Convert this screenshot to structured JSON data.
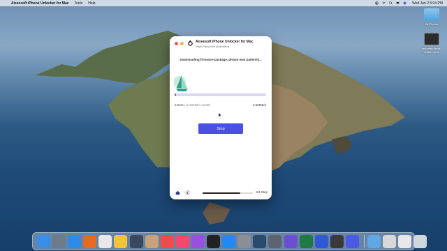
{
  "menubar": {
    "app_name": "Aiseesoft iPhone Unlocker for Mac",
    "items": [
      "Tools",
      "Help"
    ],
    "clock": "Wed Jun 2  5:04 PM"
  },
  "desktop": {
    "icons": [
      {
        "label": "All Photos",
        "icon": "folder-icon"
      },
      {
        "label": "recovery-mode-restore.mov",
        "icon": "video-file-icon"
      }
    ]
  },
  "window": {
    "title": "Aiseesoft iPhone Unlocker for Mac",
    "subtitle": "Wipe Passcode  (Activated)",
    "status_message": "Downloading firmware package, please wait patiently...",
    "progress": {
      "percent_label": "0.24%",
      "size_label": "(11.06MB/4.41GB)",
      "speed": "3.55MB/s",
      "fraction": 0.0024
    },
    "stop_label": "Stop",
    "step_label": "3/4 Step",
    "footer_progress": 0.75
  },
  "dock": {
    "apps": [
      {
        "name": "finder-icon",
        "color": "#3a8ee6"
      },
      {
        "name": "launchpad-icon",
        "color": "#6c7a8a"
      },
      {
        "name": "safari-icon",
        "color": "#2e8bea"
      },
      {
        "name": "firefox-icon",
        "color": "#e66a1f"
      },
      {
        "name": "chrome-icon",
        "color": "#e8e8e8"
      },
      {
        "name": "photos-icon",
        "color": "#f3c43b"
      },
      {
        "name": "migration-icon",
        "color": "#3a4a5e"
      },
      {
        "name": "contacts-icon",
        "color": "#c9a27a"
      },
      {
        "name": "news-icon",
        "color": "#f04a4a"
      },
      {
        "name": "music-icon",
        "color": "#f5486c"
      },
      {
        "name": "podcasts-icon",
        "color": "#9b4ee0"
      },
      {
        "name": "appletv-icon",
        "color": "#222222"
      },
      {
        "name": "appstore-icon",
        "color": "#1f8bf2"
      },
      {
        "name": "settings-icon",
        "color": "#8b8f95"
      },
      {
        "name": "quicktime-icon",
        "color": "#2a4a6e"
      },
      {
        "name": "screenshot-icon",
        "color": "#5d6470"
      },
      {
        "name": "imovie-icon",
        "color": "#6a4fd0"
      },
      {
        "name": "excel-icon",
        "color": "#1f7a43"
      },
      {
        "name": "aiseesoft-icon",
        "color": "#3058d8"
      },
      {
        "name": "unlocker-icon",
        "color": "#3a3a3a"
      },
      {
        "name": "phone-transfer-icon",
        "color": "#4b5ae6"
      }
    ],
    "right_items": [
      {
        "name": "downloads-folder-icon",
        "color": "#5fa8e4"
      },
      {
        "name": "document-stack-icon",
        "color": "#d8d8d8"
      },
      {
        "name": "preview-stack-icon",
        "color": "#e8e8e8"
      },
      {
        "name": "trash-icon",
        "color": "#cfd6dc"
      }
    ]
  }
}
